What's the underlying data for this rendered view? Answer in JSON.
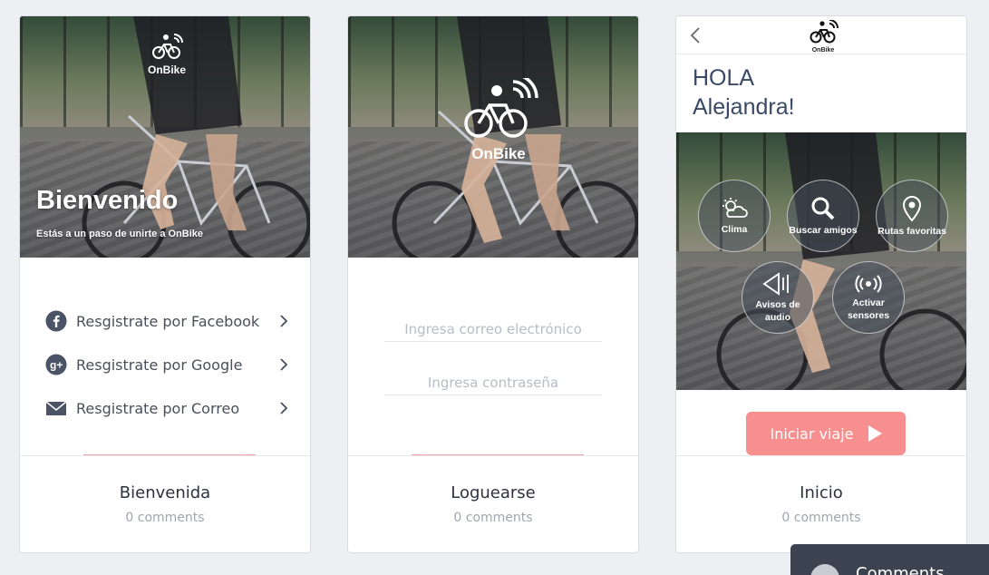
{
  "screens": [
    {
      "brand": "OnBike",
      "title": "Bienvenido",
      "subtitle": "Estás a un paso de unirte a OnBike",
      "options": [
        {
          "label": "Resgistrate por Facebook",
          "icon": "facebook-icon"
        },
        {
          "label": "Resgistrate por Google",
          "icon": "google-plus-icon"
        },
        {
          "label": "Resgistrate por Correo",
          "icon": "envelope-icon"
        }
      ],
      "footer_title": "Bienvenida",
      "footer_comments": "0 comments"
    },
    {
      "brand": "OnBike",
      "email_placeholder": "Ingresa correo electrónico",
      "password_placeholder": "Ingresa contraseña",
      "footer_title": "Loguearse",
      "footer_comments": "0 comments"
    },
    {
      "brand": "OnBike",
      "greeting_line1": "HOLA",
      "greeting_line2": "Alejandra!",
      "buttons": [
        {
          "label": "Clima",
          "icon": "weather-icon"
        },
        {
          "label": "Buscar amigos",
          "icon": "search-icon"
        },
        {
          "label": "Rutas favoritas",
          "icon": "location-pin-icon"
        },
        {
          "label": "Avisos de audio",
          "icon": "audio-icon"
        },
        {
          "label": "Activar sensores",
          "icon": "signal-icon"
        }
      ],
      "start_label": "Iniciar viaje",
      "footer_title": "Inicio",
      "footer_comments": "0 comments"
    }
  ],
  "comments_panel": {
    "label": "Comments"
  },
  "colors": {
    "accent": "#f78f8f",
    "text_dark": "#2d3240",
    "text_muted": "#a0a5ae",
    "greeting": "#3a4a66",
    "background": "#edeff3"
  }
}
